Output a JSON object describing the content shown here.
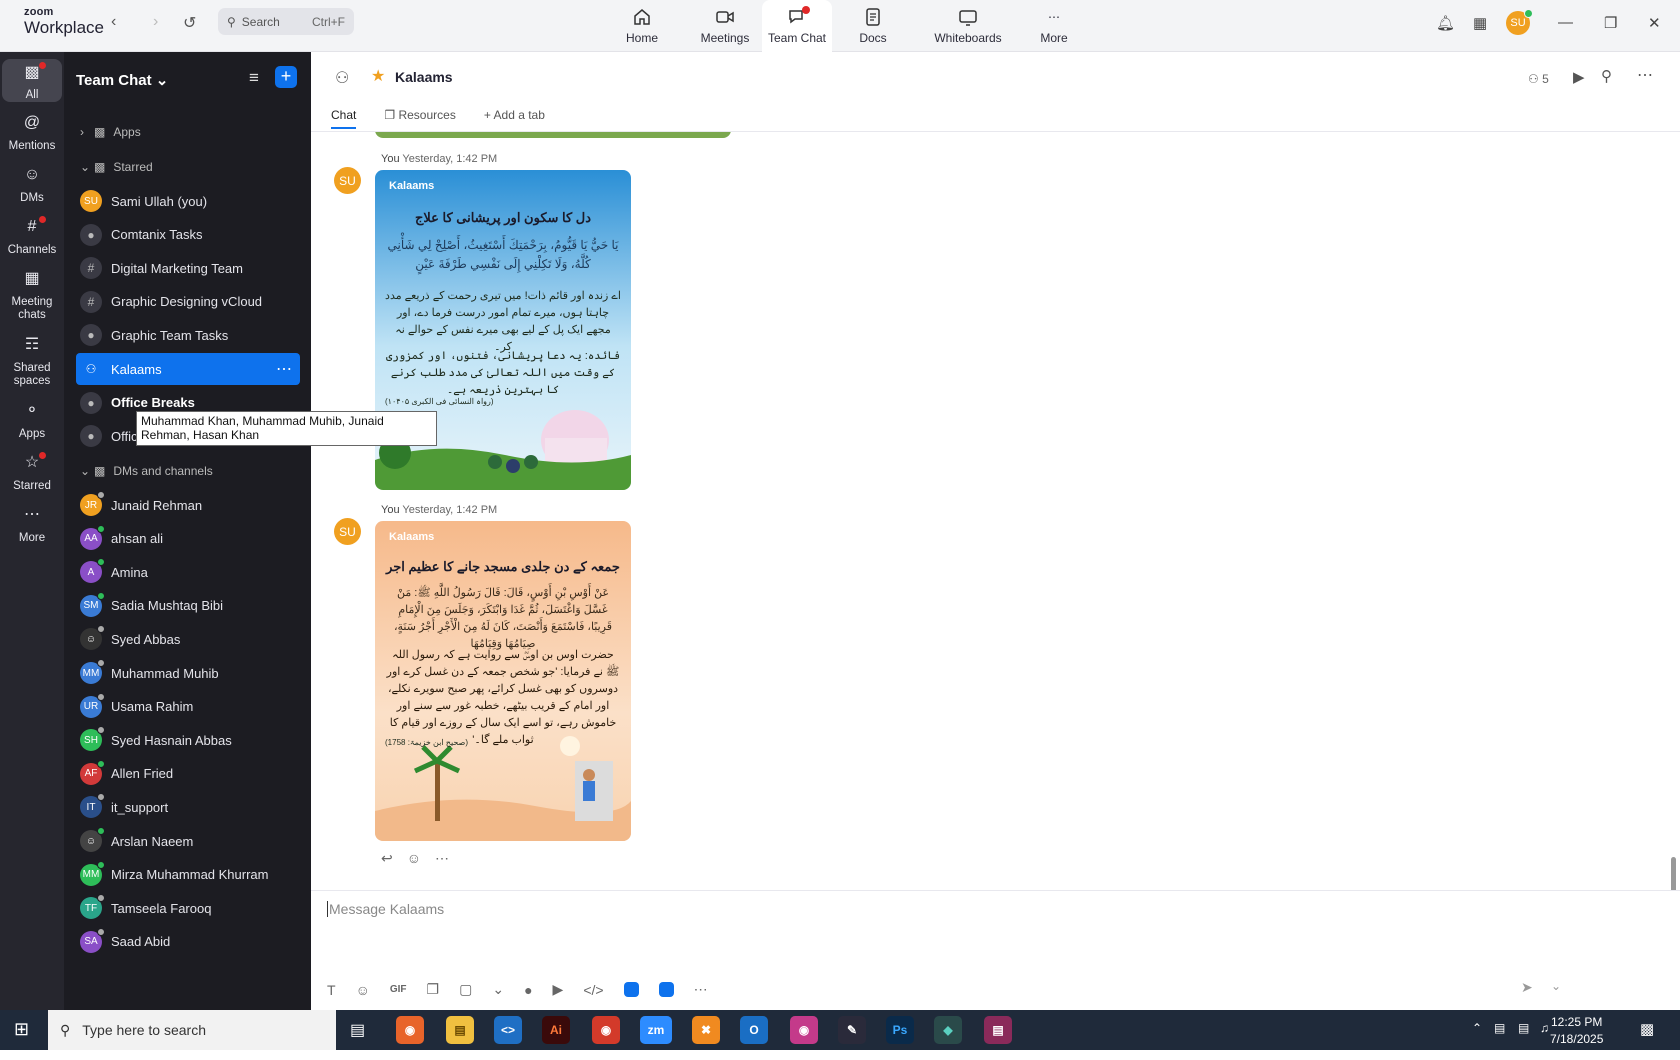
{
  "app": {
    "logo_top": "zoom",
    "logo_bottom": "Workplace"
  },
  "search": {
    "placeholder": "Search",
    "shortcut": "Ctrl+F"
  },
  "nav": [
    {
      "label": "Home"
    },
    {
      "label": "Meetings"
    },
    {
      "label": "Team Chat"
    },
    {
      "label": "Docs"
    },
    {
      "label": "Whiteboards"
    },
    {
      "label": "More"
    }
  ],
  "user": {
    "initials": "SU"
  },
  "rail": [
    {
      "label": "All"
    },
    {
      "label": "Mentions"
    },
    {
      "label": "DMs"
    },
    {
      "label": "Channels"
    },
    {
      "label": "Meeting chats"
    },
    {
      "label": "Shared spaces"
    },
    {
      "label": "Apps"
    },
    {
      "label": "Starred"
    },
    {
      "label": "More"
    }
  ],
  "sidebar": {
    "title": "Team Chat",
    "apps": "Apps",
    "starred_header": "Starred",
    "starred": [
      {
        "label": "Sami Ullah (you)",
        "initials": "SU",
        "color": "#f0a020",
        "kind": "avatar"
      },
      {
        "label": "Comtanix Tasks",
        "kind": "lock"
      },
      {
        "label": "Digital Marketing Team",
        "kind": "hash"
      },
      {
        "label": "Graphic Designing vCloud",
        "kind": "hash"
      },
      {
        "label": "Graphic Team Tasks",
        "kind": "lock"
      },
      {
        "label": "Kalaams",
        "kind": "group"
      },
      {
        "label": "Office Breaks",
        "kind": "lock"
      },
      {
        "label": "Office Breaks (IT Team)",
        "kind": "lock"
      }
    ],
    "dms_header": "DMs and channels",
    "dms": [
      {
        "label": "Junaid Rehman",
        "initials": "JR",
        "color": "#f0a020",
        "status": "#aaa"
      },
      {
        "label": "ahsan ali",
        "initials": "AA",
        "color": "#8a4fc7",
        "status": "#2ebd59"
      },
      {
        "label": "Amina",
        "initials": "A",
        "color": "#8a4fc7",
        "status": "#2ebd59"
      },
      {
        "label": "Sadia Mushtaq Bibi",
        "initials": "SM",
        "color": "#3a7bd5",
        "status": "#2ebd59"
      },
      {
        "label": "Syed Abbas",
        "initials": "",
        "color": "#333",
        "status": "#aaa"
      },
      {
        "label": "Muhammad Muhib",
        "initials": "MM",
        "color": "#3a7bd5",
        "status": "#aaa"
      },
      {
        "label": "Usama Rahim",
        "initials": "UR",
        "color": "#3a7bd5",
        "status": "#aaa"
      },
      {
        "label": "Syed Hasnain Abbas",
        "initials": "SH",
        "color": "#2ebd59",
        "status": "#aaa"
      },
      {
        "label": "Allen Fried",
        "initials": "AF",
        "color": "#d23a3a",
        "status": "#2ebd59"
      },
      {
        "label": "it_support",
        "initials": "IT",
        "color": "#2a4f8a",
        "status": "#aaa"
      },
      {
        "label": "Arslan Naeem",
        "initials": "",
        "color": "#444",
        "status": "#2ebd59"
      },
      {
        "label": "Mirza Muhammad Khurram",
        "initials": "MM",
        "color": "#2ebd59",
        "status": "#2ebd59"
      },
      {
        "label": "Tamseela Farooq",
        "initials": "TF",
        "color": "#2aa58a",
        "status": "#aaa"
      },
      {
        "label": "Saad Abid",
        "initials": "SA",
        "color": "#8a4fc7",
        "status": "#aaa"
      }
    ],
    "tooltip": "Muhammad Khan, Muhammad Muhib, Junaid Rehman, Hasan Khan"
  },
  "channel": {
    "name": "Kalaams",
    "members": "5",
    "tabs": [
      {
        "label": "Chat"
      },
      {
        "label": "Resources"
      },
      {
        "label": "Add a tab"
      }
    ]
  },
  "messages": [
    {
      "sender": "You",
      "time": "Yesterday, 1:42 PM",
      "initials": "SU",
      "brand": "Kalaams",
      "title": "دل کا سکون اور پریشانی کا علاج",
      "arabic": "يَا حَيُّ يَا قَيُّومُ، بِرَحْمَتِكَ أَسْتَغِيثُ، أَصْلِحْ لِي شَأْنِي كُلَّهُ، وَلَا تَكِلْنِي إِلَى نَفْسِي طَرْفَةَ عَيْنٍ",
      "urdu1": "اے زندہ اور قائم ذات! میں تیری رحمت کے ذریعے مدد چاہتا ہوں، میرے تمام امور درست فرما دے، اور مجھے ایک پل کے لیے بھی میرے نفس کے حوالے نہ کر۔",
      "urdu2": "فائدہ: یہ دعا پریشانی، فتنوں، اور کمزوری کے وقت میں اللہ تعالیٰ کی مدد طلب کرنے کا بہترین ذریعہ ہے۔",
      "ref": "(رواہ النسائی فی الکبری ۱۰۴۰۵)"
    },
    {
      "sender": "You",
      "time": "Yesterday, 1:42 PM",
      "initials": "SU",
      "brand": "Kalaams",
      "title": "جمعہ کے دن جلدی مسجد جانے کا عظیم اجر",
      "arabic": "عَنْ أَوْسِ بْنِ أَوْسٍ، قَالَ: قَالَ رَسُولُ اللَّهِ ﷺ: مَنْ غَسَّلَ وَاغْتَسَلَ، ثُمَّ غَدَا وَابْتَكَرَ، وَجَلَسَ مِنَ الْإِمَامِ قَرِيبًا، فَاسْتَمَعَ وَأَنْصَتَ، كَانَ لَهُ مِنَ الْأَجْرِ أَجْرُ سَنَةٍ، صِيَامُهَا وَقِيَامُهَا",
      "urdu1": "حضرت اوس بن اوسؓ سے روایت ہے کہ رسول اللہ ﷺ نے فرمایا: 'جو شخص جمعہ کے دن غسل کرے اور دوسروں کو بھی غسل کرائے، پھر صبح سویرے نکلے، اور امام کے قریب بیٹھے، خطبہ غور سے سنے اور خاموش رہے، تو اسے ایک سال کے روزے اور قیام کا ثواب ملے گا۔'",
      "ref": "(صحیح ابن خزیمۃ: 1758)"
    }
  ],
  "compose": {
    "placeholder": "Message Kalaams"
  },
  "taskbar": {
    "search": "Type here to search",
    "time": "12:25 PM",
    "date": "7/18/2025"
  }
}
